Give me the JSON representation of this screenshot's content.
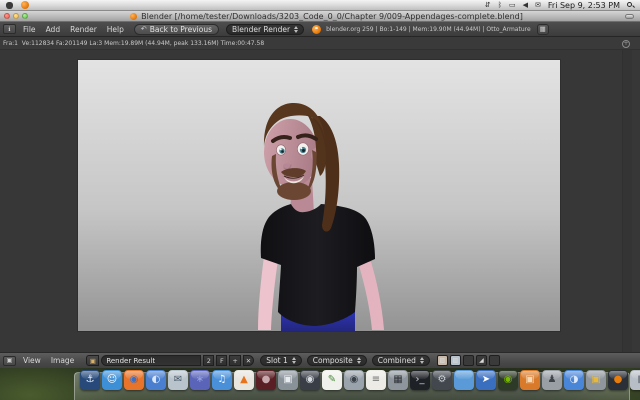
{
  "menubar": {
    "clock": "Fri Sep 9, 2:53 PM",
    "status_icons": [
      {
        "name": "sync-status-icon",
        "glyph": "⇵"
      },
      {
        "name": "bluetooth-icon",
        "glyph": "ᛒ"
      },
      {
        "name": "displays-icon",
        "glyph": "▭"
      },
      {
        "name": "volume-icon",
        "glyph": "◀"
      },
      {
        "name": "mail-status-icon",
        "glyph": "✉"
      }
    ]
  },
  "window": {
    "title": "Blender [/home/tester/Downloads/3203_Code_0_0/Chapter 9/009-Appendages-complete.blend]"
  },
  "header": {
    "menus": [
      "File",
      "Add",
      "Render",
      "Help"
    ],
    "back_button": "Back to Previous",
    "engine": "Blender Render",
    "info": "blender.org 259 | Bo:1-149  | Mem:19.90M (44.94M) | Otto_Armature"
  },
  "stats": {
    "text": "Fra:1  Ve:112834 Fa:201149 La:3 Mem:19.89M (44.94M, peak 133.16M) Time:00:47.58"
  },
  "footer": {
    "menus": [
      "View",
      "Image"
    ],
    "datablock": "Render Result",
    "users_count": "2",
    "fake_user": "F",
    "add_label": "+",
    "close_label": "✕",
    "slot": "Slot 1",
    "layer": "Composite",
    "pass": "Combined",
    "channel_buttons": [
      {
        "name": "channel-rgb-button",
        "bg": "#c8b9a8",
        "glyph": "▨"
      },
      {
        "name": "channel-rgba-button",
        "bg": "#b8c2cc",
        "glyph": "▨"
      },
      {
        "name": "channel-alpha-button",
        "bg": "#3a3a3a",
        "glyph": ""
      },
      {
        "name": "channel-z-button",
        "bg": "#3a3a3a",
        "glyph": "◢"
      },
      {
        "name": "channel-exposure-button",
        "bg": "#3a3a3a",
        "glyph": ""
      }
    ]
  },
  "colors": {
    "blender_orange": "#e87d0d",
    "render_bg_top": "#e2e2e2",
    "render_bg_bottom": "#969696",
    "skin": "#c79aa4",
    "arm_skin": "#edc3cd",
    "hair": "#58371f",
    "beard": "#6b4733",
    "shirt": "#17171b",
    "pants_blue": "#2a2fb8",
    "traffic_red": "#f25a4d",
    "traffic_yellow": "#f7b63a",
    "traffic_green": "#57c33e"
  },
  "dock": {
    "items": [
      {
        "name": "dock-anchor-app",
        "glyph": "⚓",
        "bg": "#274a7b",
        "fg": "#e8eef7"
      },
      {
        "name": "dock-finder",
        "glyph": "☺",
        "bg": "#3d8fd6",
        "fg": "#ffffff"
      },
      {
        "name": "dock-firefox",
        "glyph": "◉",
        "bg": "#e8732a",
        "fg": "#3b6fc4"
      },
      {
        "name": "dock-browser-swirl",
        "glyph": "◐",
        "bg": "#4a7fd0",
        "fg": "#dbe7f8"
      },
      {
        "name": "dock-mail",
        "glyph": "✉",
        "bg": "#b9c3cc",
        "fg": "#4a5a68"
      },
      {
        "name": "dock-grapes-app",
        "glyph": "∗",
        "bg": "#5a64b8",
        "fg": "#9aa2e0"
      },
      {
        "name": "dock-itunes",
        "glyph": "♫",
        "bg": "#4a90d9",
        "fg": "#ffffff"
      },
      {
        "name": "dock-vlc",
        "glyph": "▲",
        "bg": "#e8e4de",
        "fg": "#e8731a"
      },
      {
        "name": "dock-dvd-player",
        "glyph": "●",
        "bg": "#5a1f24",
        "fg": "#c8a9ad"
      },
      {
        "name": "dock-photos-stack",
        "glyph": "▣",
        "bg": "#8a9299",
        "fg": "#e8ecf0"
      },
      {
        "name": "dock-photo-booth",
        "glyph": "◉",
        "bg": "#3a3f47",
        "fg": "#d8dce2"
      },
      {
        "name": "dock-quill-app",
        "glyph": "✎",
        "bg": "#f0f0ec",
        "fg": "#4a8a3a"
      },
      {
        "name": "dock-camera-app",
        "glyph": "◉",
        "bg": "#9aa2ab",
        "fg": "#3a4048"
      },
      {
        "name": "dock-textedit",
        "glyph": "≡",
        "bg": "#ecebe6",
        "fg": "#6a6a6a"
      },
      {
        "name": "dock-calculator",
        "glyph": "▦",
        "bg": "#8e959c",
        "fg": "#2f3338"
      },
      {
        "name": "dock-terminal",
        "glyph": "›_",
        "bg": "#1e2126",
        "fg": "#cfd4da"
      },
      {
        "name": "dock-system-preferences",
        "glyph": "⚙",
        "bg": "#43484f",
        "fg": "#c8cdd4"
      },
      {
        "name": "dock-folder",
        "glyph": "",
        "bg": "#5a9ad8",
        "fg": "#cfe2f4"
      },
      {
        "name": "dock-remote-desktop",
        "glyph": "➤",
        "bg": "#3a6fc0",
        "fg": "#ffffff"
      },
      {
        "name": "dock-nvidia",
        "glyph": "◉",
        "bg": "#2e3a28",
        "fg": "#76b900"
      },
      {
        "name": "dock-orange-app",
        "glyph": "▣",
        "bg": "#d87a2a",
        "fg": "#f4d8b8"
      },
      {
        "name": "dock-robot-app",
        "glyph": "♟",
        "bg": "#9a9fa6",
        "fg": "#3f444a"
      },
      {
        "name": "dock-quicktime",
        "glyph": "◑",
        "bg": "#4a86d8",
        "fg": "#dbe8f8"
      },
      {
        "name": "dock-iphoto",
        "glyph": "▣",
        "bg": "#8f969d",
        "fg": "#e8b83a"
      },
      {
        "name": "dock-blender",
        "glyph": "●",
        "bg": "#2a2f38",
        "fg": "#e87d0d"
      },
      {
        "name": "dock-trash",
        "glyph": "▮",
        "bg": "#b8bec5",
        "fg": "#7a8088"
      }
    ]
  }
}
